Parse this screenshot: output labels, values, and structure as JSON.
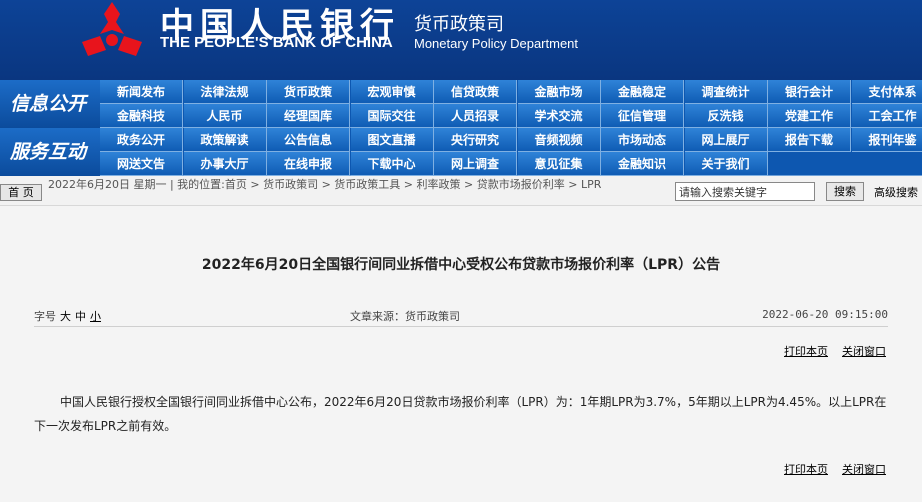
{
  "header": {
    "bank_cn": "中国人民银行",
    "bank_en": "THE PEOPLE'S BANK OF CHINA",
    "dept_cn": "货币政策司",
    "dept_en": "Monetary Policy Department"
  },
  "nav": {
    "section1": "信息公开",
    "section2": "服务互动",
    "row1": [
      "新闻发布",
      "法律法规",
      "货币政策",
      "宏观审慎",
      "信贷政策",
      "金融市场",
      "金融稳定",
      "调查统计",
      "银行会计",
      "支付体系"
    ],
    "row2": [
      "金融科技",
      "人民币",
      "经理国库",
      "国际交往",
      "人员招录",
      "学术交流",
      "征信管理",
      "反洗钱",
      "党建工作",
      "工会工作"
    ],
    "row3": [
      "政务公开",
      "政策解读",
      "公告信息",
      "图文直播",
      "央行研究",
      "音频视频",
      "市场动态",
      "网上展厅",
      "报告下载",
      "报刊年鉴"
    ],
    "row4": [
      "网送文告",
      "办事大厅",
      "在线申报",
      "下载中心",
      "网上调查",
      "意见征集",
      "金融知识",
      "关于我们"
    ]
  },
  "breadcrumb": {
    "home_label": "首 页",
    "text": "2022年6月20日 星期一 | 我的位置:首页 > 货币政策司 > 货币政策工具 > 利率政策 > 贷款市场报价利率 > LPR",
    "search_placeholder": "请输入搜索关键字",
    "search_button": "搜索",
    "advanced_search": "高级搜索"
  },
  "article": {
    "title": "2022年6月20日全国银行间同业拆借中心受权公布贷款市场报价利率（LPR）公告",
    "font_size_label": "字号",
    "size_large": "大",
    "size_medium": "中",
    "size_small": "小",
    "source": "文章来源：货币政策司",
    "date": "2022-06-20 09:15:00",
    "print": "打印本页",
    "close": "关闭窗口",
    "body": "中国人民银行授权全国银行间同业拆借中心公布，2022年6月20日贷款市场报价利率（LPR）为：1年期LPR为3.7%，5年期以上LPR为4.45%。以上LPR在下一次发布LPR之前有效。"
  }
}
